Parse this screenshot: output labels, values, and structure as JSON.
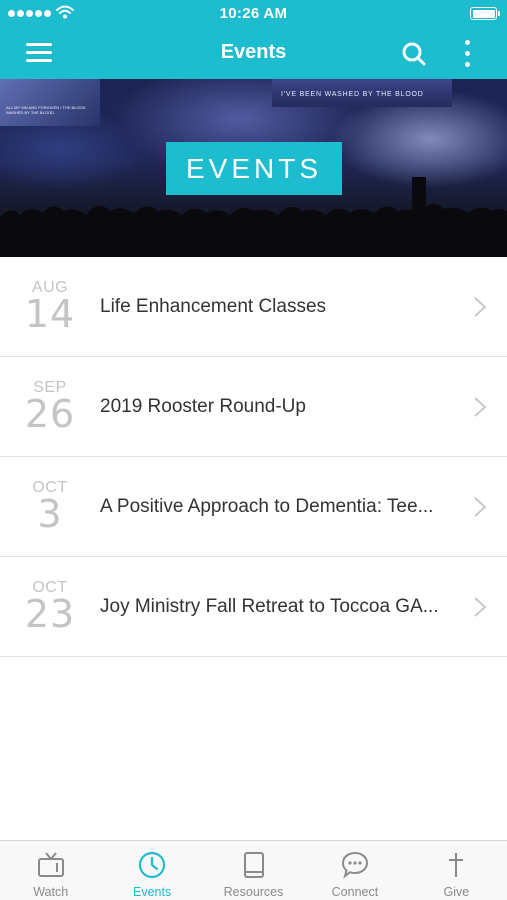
{
  "status_bar": {
    "time": "10:26 AM"
  },
  "nav": {
    "title": "Events"
  },
  "banner": {
    "label": "EVENTS",
    "screen_text": "I'VE BEEN WASHED BY THE BLOOD",
    "left_screen_text": "ALL MY SIN AND FORGIVEN / THE BLOOD WASHED BY THE BLOOD"
  },
  "events": [
    {
      "month": "AUG",
      "day": "14",
      "title": "Life Enhancement Classes"
    },
    {
      "month": "SEP",
      "day": "26",
      "title": "2019 Rooster Round-Up"
    },
    {
      "month": "OCT",
      "day": "3",
      "title": "A Positive Approach to Dementia: Tee..."
    },
    {
      "month": "OCT",
      "day": "23",
      "title": "Joy Ministry Fall Retreat to Toccoa GA..."
    }
  ],
  "tabs": [
    {
      "label": "Watch",
      "icon": "tv-icon"
    },
    {
      "label": "Events",
      "icon": "clock-icon",
      "active": true
    },
    {
      "label": "Resources",
      "icon": "book-icon"
    },
    {
      "label": "Connect",
      "icon": "chat-icon"
    },
    {
      "label": "Give",
      "icon": "cross-icon"
    }
  ],
  "colors": {
    "accent": "#1ebccf",
    "tab_inactive": "#8a8a8a",
    "date_gray": "#c4c4c4"
  }
}
